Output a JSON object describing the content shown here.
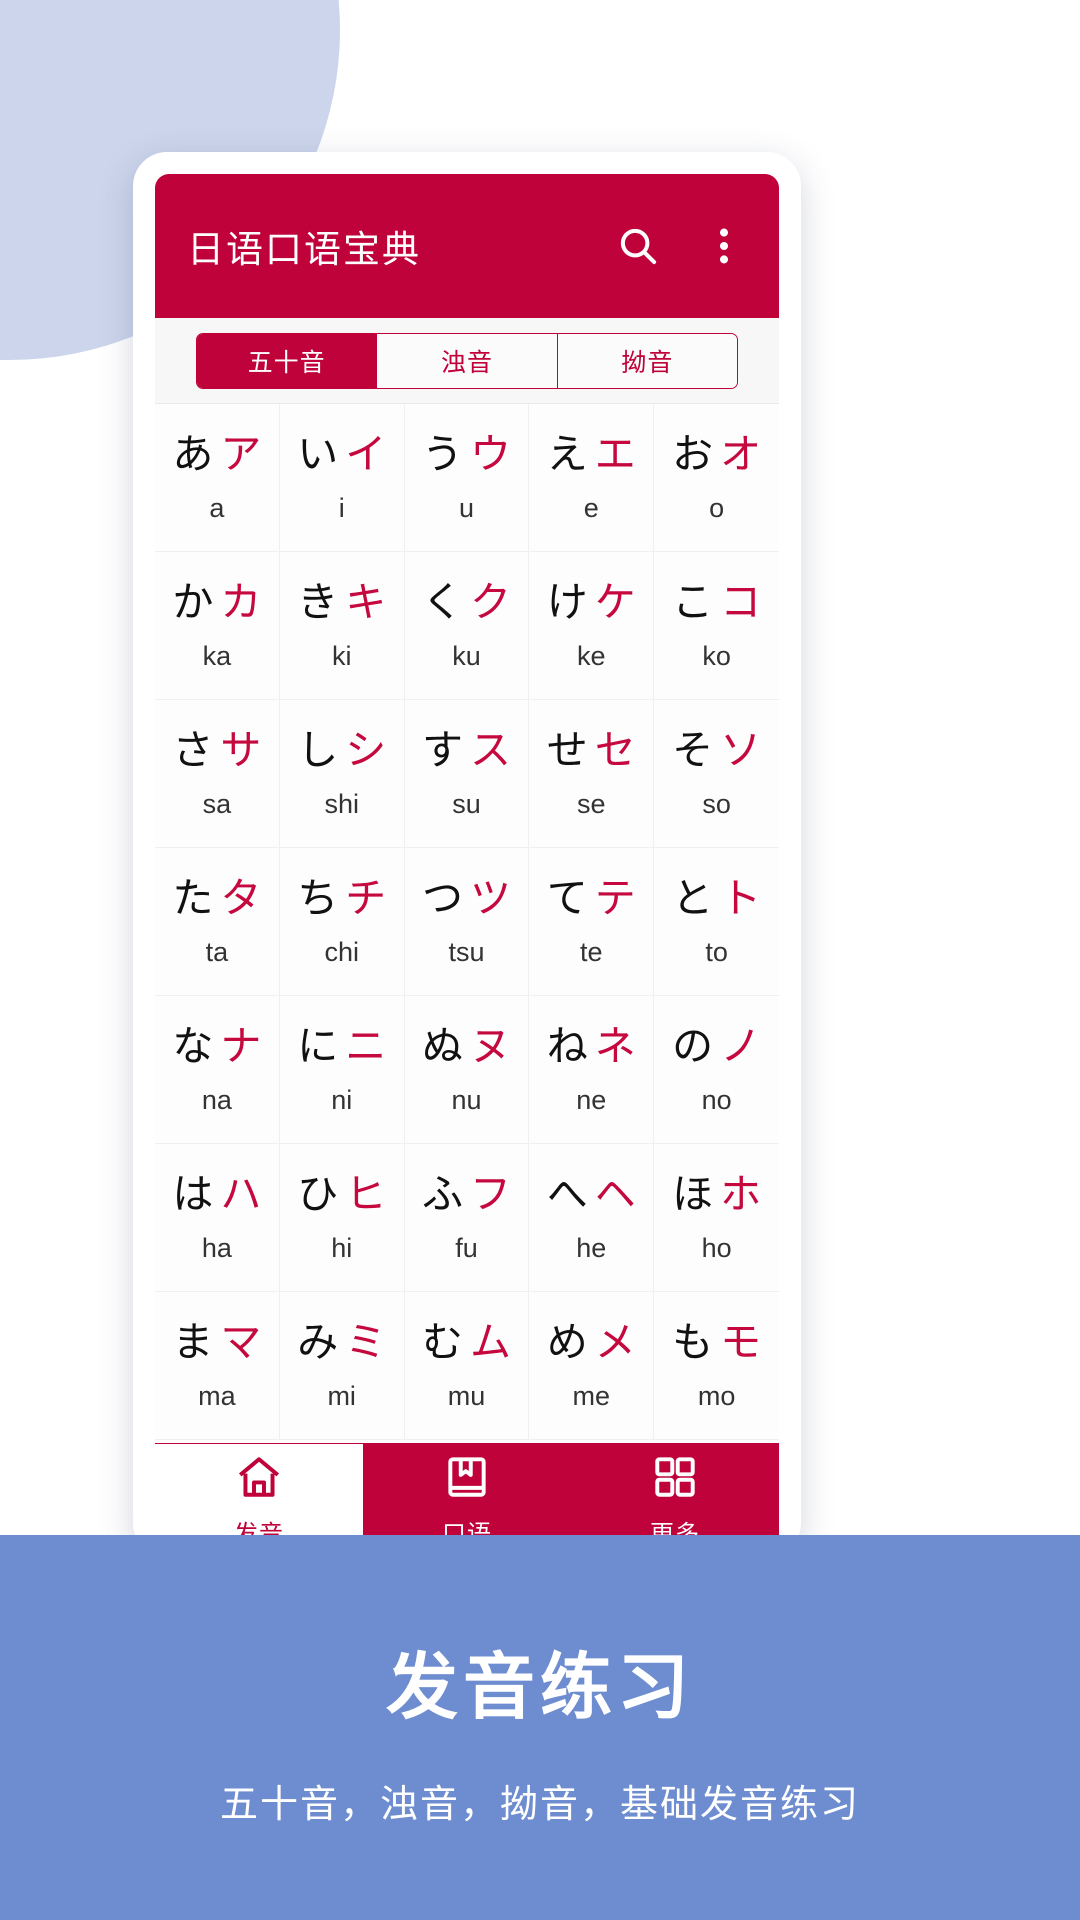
{
  "background": {
    "circle_color": "#ccd5ec",
    "page_color": "#ffffff"
  },
  "theme": {
    "accent": "#bf0239",
    "kata_color": "#c5093f",
    "banner_bg": "#6e8dd0"
  },
  "app_bar": {
    "title": "日语口语宝典",
    "search_icon": "search-icon",
    "overflow_icon": "more-vertical-icon"
  },
  "tabs": [
    {
      "label": "五十音",
      "active": true
    },
    {
      "label": "浊音",
      "active": false
    },
    {
      "label": "拗音",
      "active": false
    }
  ],
  "kana_grid": [
    {
      "hira": "あ",
      "kata": "ア",
      "romaji": "a"
    },
    {
      "hira": "い",
      "kata": "イ",
      "romaji": "i"
    },
    {
      "hira": "う",
      "kata": "ウ",
      "romaji": "u"
    },
    {
      "hira": "え",
      "kata": "エ",
      "romaji": "e"
    },
    {
      "hira": "お",
      "kata": "オ",
      "romaji": "o"
    },
    {
      "hira": "か",
      "kata": "カ",
      "romaji": "ka"
    },
    {
      "hira": "き",
      "kata": "キ",
      "romaji": "ki"
    },
    {
      "hira": "く",
      "kata": "ク",
      "romaji": "ku"
    },
    {
      "hira": "け",
      "kata": "ケ",
      "romaji": "ke"
    },
    {
      "hira": "こ",
      "kata": "コ",
      "romaji": "ko"
    },
    {
      "hira": "さ",
      "kata": "サ",
      "romaji": "sa"
    },
    {
      "hira": "し",
      "kata": "シ",
      "romaji": "shi"
    },
    {
      "hira": "す",
      "kata": "ス",
      "romaji": "su"
    },
    {
      "hira": "せ",
      "kata": "セ",
      "romaji": "se"
    },
    {
      "hira": "そ",
      "kata": "ソ",
      "romaji": "so"
    },
    {
      "hira": "た",
      "kata": "タ",
      "romaji": "ta"
    },
    {
      "hira": "ち",
      "kata": "チ",
      "romaji": "chi"
    },
    {
      "hira": "つ",
      "kata": "ツ",
      "romaji": "tsu"
    },
    {
      "hira": "て",
      "kata": "テ",
      "romaji": "te"
    },
    {
      "hira": "と",
      "kata": "ト",
      "romaji": "to"
    },
    {
      "hira": "な",
      "kata": "ナ",
      "romaji": "na"
    },
    {
      "hira": "に",
      "kata": "ニ",
      "romaji": "ni"
    },
    {
      "hira": "ぬ",
      "kata": "ヌ",
      "romaji": "nu"
    },
    {
      "hira": "ね",
      "kata": "ネ",
      "romaji": "ne"
    },
    {
      "hira": "の",
      "kata": "ノ",
      "romaji": "no"
    },
    {
      "hira": "は",
      "kata": "ハ",
      "romaji": "ha"
    },
    {
      "hira": "ひ",
      "kata": "ヒ",
      "romaji": "hi"
    },
    {
      "hira": "ふ",
      "kata": "フ",
      "romaji": "fu"
    },
    {
      "hira": "へ",
      "kata": "ヘ",
      "romaji": "he"
    },
    {
      "hira": "ほ",
      "kata": "ホ",
      "romaji": "ho"
    },
    {
      "hira": "ま",
      "kata": "マ",
      "romaji": "ma"
    },
    {
      "hira": "み",
      "kata": "ミ",
      "romaji": "mi"
    },
    {
      "hira": "む",
      "kata": "ム",
      "romaji": "mu"
    },
    {
      "hira": "め",
      "kata": "メ",
      "romaji": "me"
    },
    {
      "hira": "も",
      "kata": "モ",
      "romaji": "mo"
    }
  ],
  "bottom_nav": [
    {
      "label": "发音",
      "icon": "home-icon",
      "active": true
    },
    {
      "label": "口语",
      "icon": "book-icon",
      "active": false
    },
    {
      "label": "更多",
      "icon": "grid-icon",
      "active": false
    }
  ],
  "banner": {
    "title": "发音练习",
    "subtitle": "五十音，浊音，拗音，基础发音练习"
  }
}
